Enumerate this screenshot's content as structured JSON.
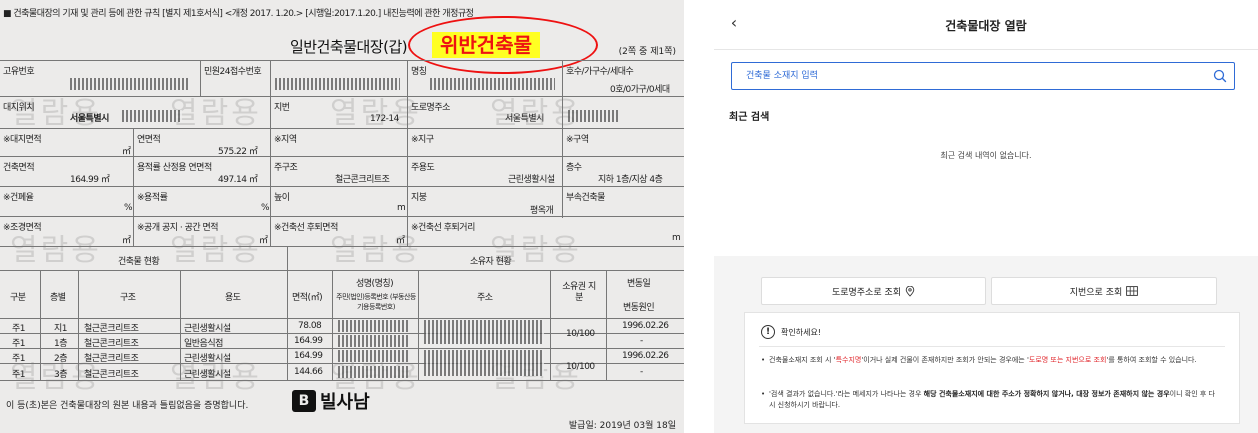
{
  "document": {
    "regulation_line": "■ 건축물대장의 기재 및 관리 등에 관한 규칙 [별지 제1호서식] <개정 2017. 1.20.> [시행일:2017.1.20.] 내진능력에 관한 개정규정",
    "title": "일반건축물대장(갑)",
    "stamp": "위반건축물",
    "pages": "(2쪽 중 제1쪽)",
    "watermark": "열람용",
    "labels": {
      "unique_no": "고유번호",
      "civil_no": "민원24접수번호",
      "name": "명칭",
      "households": "호수/가구수/세대수",
      "households_value": "0호/0가구/0세대",
      "site_location": "대지위치",
      "site_location_value": "서울특별시",
      "lot_no": "지번",
      "lot_no_value": "172-14",
      "road_address": "도로명주소",
      "road_address_value": "서울특별시",
      "site_area": "※대지면적",
      "site_area_unit": "㎡",
      "total_area": "연면적",
      "total_area_value": "575.22 ㎡",
      "zone": "※지역",
      "district": "※지구",
      "area": "※구역",
      "building_area": "건축면적",
      "building_area_value": "164.99 ㎡",
      "ratio_area": "용적률 산정용 연면적",
      "ratio_area_value": "497.14 ㎡",
      "main_structure": "주구조",
      "main_structure_value": "철근콘크리트조",
      "main_use": "주용도",
      "main_use_value": "근린생활시설",
      "floors": "층수",
      "floors_value": "지하 1층/지상 4층",
      "coverage": "※건폐율",
      "coverage_unit": "%",
      "far": "※용적률",
      "far_unit": "%",
      "height": "높이",
      "height_unit": "m",
      "roof": "지붕",
      "roof_value": "평옥개",
      "annex": "부속건축물",
      "landscape": "※조경면적",
      "landscape_unit": "㎡",
      "public_space": "※공개 공지 · 공간 면적",
      "public_space_unit": "㎡",
      "setback_area": "※건축선 후퇴면적",
      "setback_area_unit": "㎡",
      "setback_dist": "※건축선 후퇴거리",
      "setback_dist_unit": "m",
      "building_status": "건축물 현황",
      "owner_status": "소유자 현황"
    },
    "table_headers": [
      "구분",
      "층별",
      "구조",
      "용도",
      "면적(㎡)",
      "성명(명칭)",
      "주민(법인)등록번호 (부동산등기용등록번호)",
      "주소",
      "소유권 지분",
      "변동일",
      "변동원인"
    ],
    "rows": [
      {
        "type": "주1",
        "floor": "지1",
        "structure": "철근콘크리트조",
        "use": "근린생활시설",
        "area": "78.08",
        "share": "10/100",
        "date": "1996.02.26"
      },
      {
        "type": "주1",
        "floor": "1층",
        "structure": "철근콘크리트조",
        "use": "일반음식점",
        "area": "164.99",
        "share": "",
        "date": "-"
      },
      {
        "type": "주1",
        "floor": "2층",
        "structure": "철근콘크리트조",
        "use": "근린생활시설",
        "area": "164.99",
        "share": "10/100",
        "date": "1996.02.26"
      },
      {
        "type": "주1",
        "floor": "3층",
        "structure": "철근콘크리트조",
        "use": "근린생활시설",
        "area": "144.66",
        "share": "",
        "date": "-"
      }
    ],
    "footer": "이 등(초)본은 건축물대장의 원본 내용과 틀림없음을 증명합니다.",
    "brand": "빌사남",
    "brand_logo": "B",
    "issued": "발급일: 2019년 03월 18일"
  },
  "panel": {
    "back_icon": "‹",
    "title": "건축물대장 열람",
    "search_placeholder": "건축물 소재지 입력",
    "recent_title": "최근 검색",
    "recent_empty": "최근 검색 내역이 없습니다.",
    "btn_road": "도로명주소로 조회",
    "btn_lot": "지번으로 조회",
    "notice_title": "확인하세요!",
    "notice_icon": "!",
    "notice1_a": "건축물소재지 조회 시 '",
    "notice1_red1": "특수지명",
    "notice1_b": "'이거나 실제 건물이 존재하지만 조회가 안되는 경우에는 '",
    "notice1_red2": "도로명 또는 지번으로 조회",
    "notice1_c": "'를 통하여 조회할 수 있습니다.",
    "notice2_a": "'검색 결과가 없습니다.'라는 메세지가 나타나는 경우 ",
    "notice2_strong": "해당 건축물소재지에 대한 주소가 정확하지 않거나, 대장 정보가 존재하지 않는 경우",
    "notice2_b": "이니 확인 후 다시 신청하시기 바랍니다."
  }
}
